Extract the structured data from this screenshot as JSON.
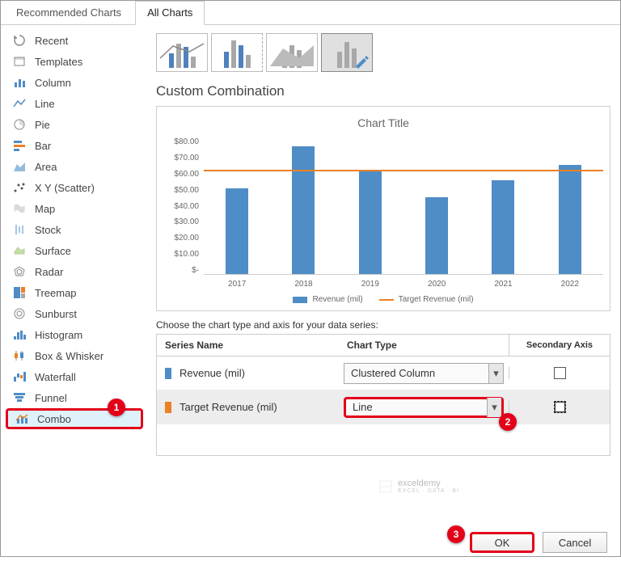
{
  "tabs": {
    "recommended": "Recommended Charts",
    "all": "All Charts"
  },
  "sidebar": {
    "items": [
      {
        "label": "Recent"
      },
      {
        "label": "Templates"
      },
      {
        "label": "Column"
      },
      {
        "label": "Line"
      },
      {
        "label": "Pie"
      },
      {
        "label": "Bar"
      },
      {
        "label": "Area"
      },
      {
        "label": "X Y (Scatter)"
      },
      {
        "label": "Map"
      },
      {
        "label": "Stock"
      },
      {
        "label": "Surface"
      },
      {
        "label": "Radar"
      },
      {
        "label": "Treemap"
      },
      {
        "label": "Sunburst"
      },
      {
        "label": "Histogram"
      },
      {
        "label": "Box & Whisker"
      },
      {
        "label": "Waterfall"
      },
      {
        "label": "Funnel"
      },
      {
        "label": "Combo"
      }
    ]
  },
  "heading": "Custom Combination",
  "chart_data": {
    "type": "combo",
    "title": "Chart Title",
    "categories": [
      "2017",
      "2018",
      "2019",
      "2020",
      "2021",
      "2022"
    ],
    "ylabel": "",
    "y_ticks": [
      "$80.00",
      "$70.00",
      "$60.00",
      "$50.00",
      "$40.00",
      "$30.00",
      "$20.00",
      "$10.00",
      "$-"
    ],
    "ylim": [
      0,
      80
    ],
    "series": [
      {
        "name": "Revenue (mil)",
        "type": "bar",
        "values": [
          50,
          75,
          60,
          45,
          55,
          64
        ]
      },
      {
        "name": "Target Revenue (mil)",
        "type": "line",
        "values": [
          60,
          60,
          60,
          60,
          60,
          60
        ]
      }
    ]
  },
  "instruction": "Choose the chart type and axis for your data series:",
  "table": {
    "head_name": "Series Name",
    "head_type": "Chart Type",
    "head_axis": "Secondary Axis",
    "rows": [
      {
        "name": "Revenue (mil)",
        "color": "#4e8dc6",
        "type": "Clustered Column",
        "secondary": false
      },
      {
        "name": "Target Revenue (mil)",
        "color": "#eb8124",
        "type": "Line",
        "secondary": false
      }
    ]
  },
  "buttons": {
    "ok": "OK",
    "cancel": "Cancel"
  },
  "callouts": {
    "one": "1",
    "two": "2",
    "three": "3"
  },
  "watermark": {
    "name": "exceldemy",
    "sub": "EXCEL · DATA · BI"
  }
}
